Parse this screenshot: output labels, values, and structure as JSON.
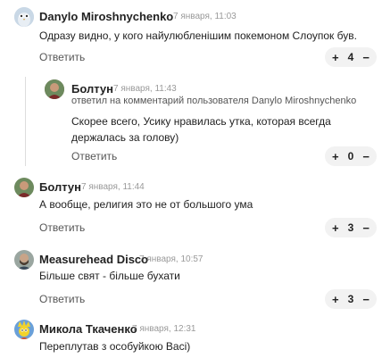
{
  "comments": [
    {
      "author": "Danylo Miroshnychenko",
      "date": "7 января, 11:03",
      "text": "Одразу видно, у кого найулюбленішим покемоном Слоупок був.",
      "reply_label": "Ответить",
      "vote_count": "4",
      "plus": "+",
      "minus": "−",
      "avatar_icon": "owl-avatar-icon"
    },
    {
      "author": "Болтун",
      "date": "7 января, 11:43",
      "reply_to": "ответил на комментарий пользователя Danylo Miroshnychenko",
      "text": "Скорее всего, Усику нравилась утка, которая всегда держалась за голову)",
      "reply_label": "Ответить",
      "vote_count": "0",
      "plus": "+",
      "minus": "−",
      "avatar_icon": "man-avatar-icon"
    },
    {
      "author": "Болтун",
      "date": "7 января, 11:44",
      "text": "А вообще, религия это не от большого ума",
      "reply_label": "Ответить",
      "vote_count": "3",
      "plus": "+",
      "minus": "−",
      "avatar_icon": "man-avatar-icon"
    },
    {
      "author": "Measurehead Disco",
      "date": "7 января, 10:57",
      "text": "Більше свят - більше бухати",
      "reply_label": "Ответить",
      "vote_count": "3",
      "plus": "+",
      "minus": "−",
      "avatar_icon": "bearded-man-avatar-icon"
    },
    {
      "author": "Микола Ткаченко",
      "date": "7 января, 12:31",
      "text": "Переплутав з особуйкою Васі)",
      "avatar_icon": "simpson-avatar-icon"
    }
  ]
}
